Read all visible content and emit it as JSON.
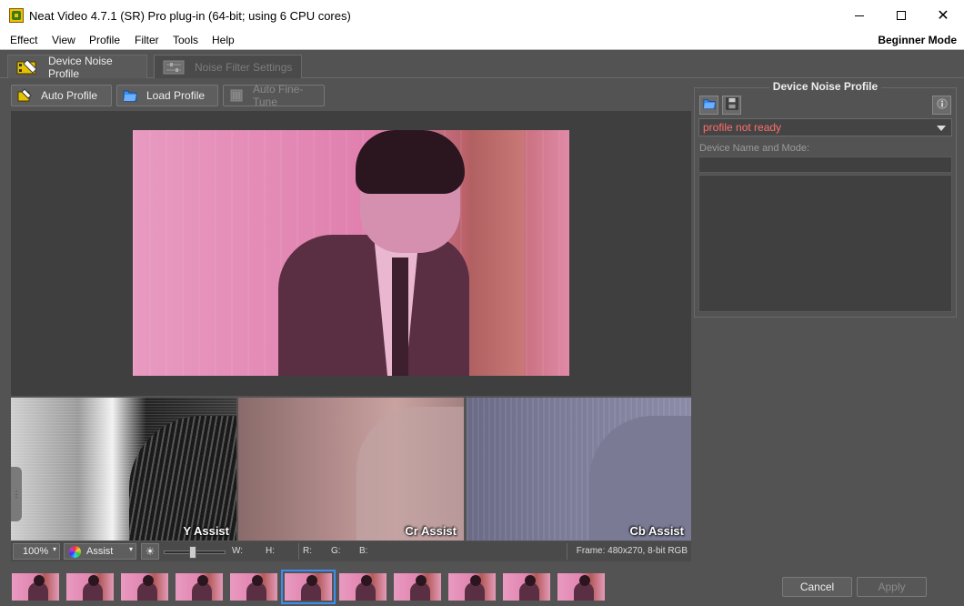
{
  "window": {
    "title": "Neat Video 4.7.1 (SR) Pro plug-in (64-bit; using 6 CPU cores)"
  },
  "menu": {
    "items": [
      "Effect",
      "View",
      "Profile",
      "Filter",
      "Tools",
      "Help"
    ],
    "mode_label": "Beginner Mode"
  },
  "tabs": [
    {
      "label": "Device Noise Profile",
      "active": true
    },
    {
      "label": "Noise Filter Settings",
      "active": false
    }
  ],
  "toolbar": {
    "auto_profile": "Auto Profile",
    "load_profile": "Load Profile",
    "auto_fine_tune": "Auto Fine-Tune"
  },
  "assist_panels": {
    "y": "Y Assist",
    "cr": "Cr Assist",
    "cb": "Cb Assist"
  },
  "statusbar": {
    "zoom": "100%",
    "assist_mode": "Assist",
    "w_label": "W:",
    "h_label": "H:",
    "r_label": "R:",
    "g_label": "G:",
    "b_label": "B:",
    "frame_info": "Frame: 480x270, 8-bit RGB"
  },
  "right_panel": {
    "title": "Device Noise Profile",
    "profile_status": "profile not ready",
    "device_label": "Device Name and Mode:",
    "device_value": ""
  },
  "thumbnails": {
    "count": 11,
    "selected_index": 5
  },
  "footer": {
    "cancel": "Cancel",
    "apply": "Apply"
  },
  "colors": {
    "accent": "#3a8ef0",
    "warning_text": "#ff6e6e"
  }
}
